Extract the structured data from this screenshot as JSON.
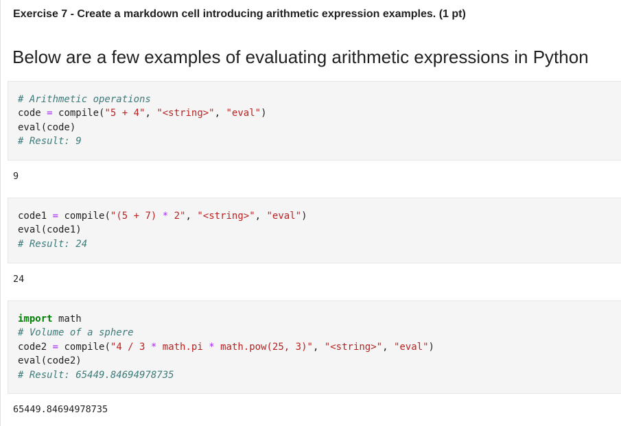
{
  "exercise": {
    "title": "Exercise 7 - Create a markdown cell introducing arithmetic expression examples. (1 pt)"
  },
  "markdown": {
    "heading": "Below are a few examples of evaluating arithmetic expressions in Python"
  },
  "cells": [
    {
      "code": {
        "l1": "# Arithmetic operations",
        "l2_var": "code",
        "l2_eq": "=",
        "l2_fn": " compile(",
        "l2_s1": "\"5 + 4\"",
        "l2_c1": ", ",
        "l2_s2": "\"<string>\"",
        "l2_c2": ", ",
        "l2_s3": "\"eval\"",
        "l2_end": ")",
        "l3": "eval(code)",
        "l4": "# Result: 9"
      },
      "output": "9"
    },
    {
      "code": {
        "l1_var": "code1",
        "l1_eq": "=",
        "l1_fn": " compile(",
        "l1_s1a": "\"(5 + 7) ",
        "l1_op": "*",
        "l1_s1b": " 2\"",
        "l1_c1": ", ",
        "l1_s2": "\"<string>\"",
        "l1_c2": ", ",
        "l1_s3": "\"eval\"",
        "l1_end": ")",
        "l2": "eval(code1)",
        "l3": "# Result: 24"
      },
      "output": "24"
    },
    {
      "code": {
        "l1_kw": "import",
        "l1_rest": " math",
        "l2": "# Volume of a sphere",
        "l3_var": "code2",
        "l3_eq": "=",
        "l3_fn": " compile(",
        "l3_s1a": "\"4 / 3 ",
        "l3_op1": "*",
        "l3_s1b": " math.pi ",
        "l3_op2": "*",
        "l3_s1c": " math.pow(25, 3)\"",
        "l3_c1": ", ",
        "l3_s2": "\"<string>\"",
        "l3_c2": ", ",
        "l3_s3": "\"eval\"",
        "l3_end": ")",
        "l4": "eval(code2)",
        "l5": "# Result: 65449.84694978735"
      },
      "output": "65449.84694978735"
    }
  ],
  "colors": {
    "comment": "#3d7a7a",
    "string": "#ba2121",
    "operator": "#aa22ff",
    "keyword": "#008000",
    "cell_background": "#f5f5f5"
  }
}
